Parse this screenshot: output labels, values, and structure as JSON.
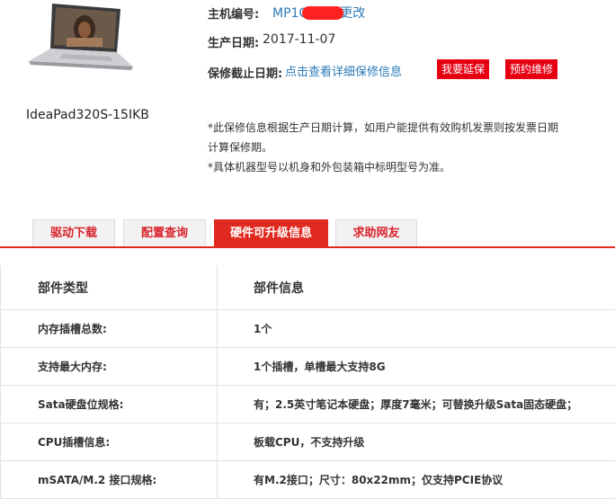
{
  "product": {
    "model": "IdeaPad320S-15IKB"
  },
  "info": {
    "serial_label": "主机编号:",
    "serial_prefix": "MP1C",
    "serial_change": "更改",
    "date_label": "生产日期:",
    "date_value": "2017-11-07",
    "warranty_label": "保修截止日期:",
    "warranty_link": "点击查看详细保修信息",
    "extend_button": "我要延保",
    "repair_button": "预约维修"
  },
  "notes": {
    "line1": "*此保修信息根据生产日期计算，如用户能提供有效购机发票则按发票日期",
    "line2": "计算保修期。",
    "line3": "*具体机器型号以机身和外包装箱中标明型号为准。"
  },
  "tabs": [
    {
      "label": "驱动下载",
      "active": false
    },
    {
      "label": "配置查询",
      "active": false
    },
    {
      "label": "硬件可升级信息",
      "active": true
    },
    {
      "label": "求助网友",
      "active": false
    }
  ],
  "table": {
    "headers": [
      "部件类型",
      "部件信息"
    ],
    "rows": [
      [
        "内存插槽总数:",
        "1个"
      ],
      [
        "支持最大内存:",
        "1个插槽，单槽最大支持8G"
      ],
      [
        "Sata硬盘位规格:",
        "有；2.5英寸笔记本硬盘；厚度7毫米；可替换升级Sata固态硬盘；"
      ],
      [
        "CPU插槽信息:",
        "板载CPU，不支持升级"
      ],
      [
        "mSATA/M.2 接口规格:",
        "有M.2接口；尺寸：80x22mm；仅支持PCIE协议"
      ]
    ]
  },
  "colors": {
    "accent": "#e02a20",
    "link": "#2a7ab8"
  }
}
